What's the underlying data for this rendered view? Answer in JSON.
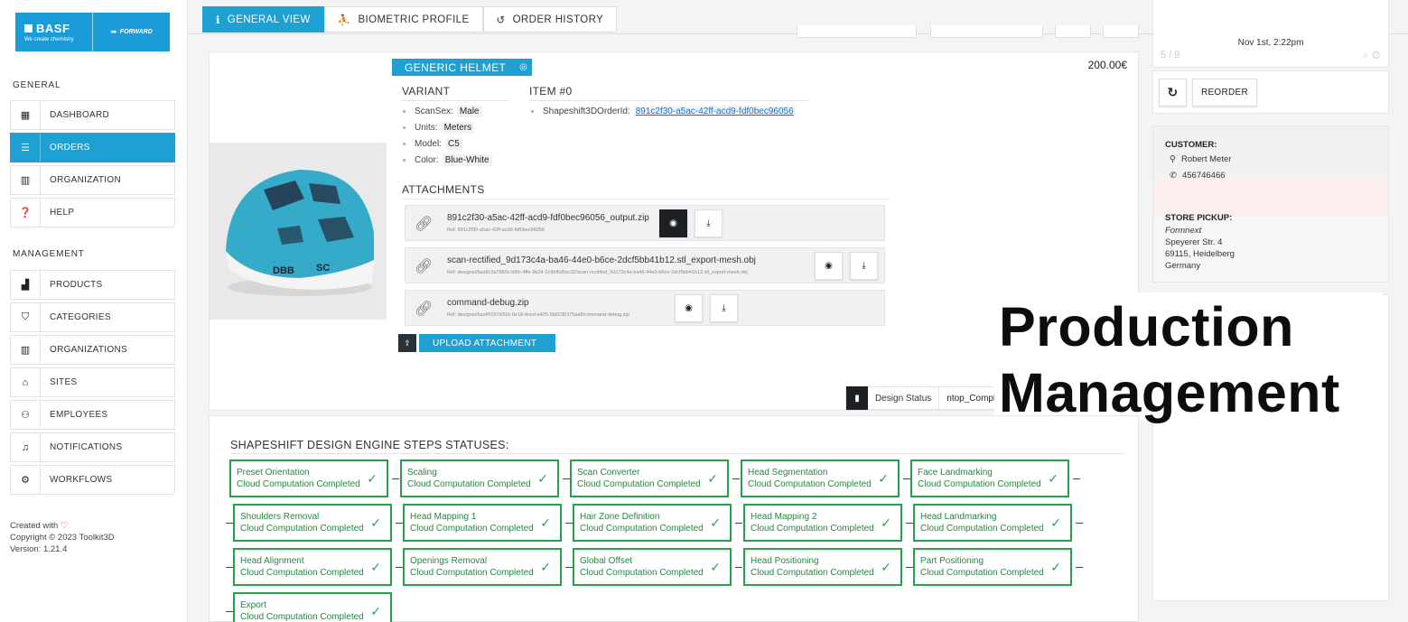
{
  "brand": {
    "name": "BASF",
    "tagline": "We create chemistry",
    "partner": "FORWARD",
    "accent": "#1fa0d2"
  },
  "sidebar": {
    "general_title": "GENERAL",
    "general_items": [
      {
        "label": "DASHBOARD",
        "icon": "dashboard-icon"
      },
      {
        "label": "ORDERS",
        "icon": "orders-icon",
        "active": true
      },
      {
        "label": "ORGANIZATION",
        "icon": "building-icon"
      },
      {
        "label": "HELP",
        "icon": "help-icon"
      }
    ],
    "management_title": "MANAGEMENT",
    "management_items": [
      {
        "label": "PRODUCTS",
        "icon": "products-icon"
      },
      {
        "label": "CATEGORIES",
        "icon": "bookmark-icon"
      },
      {
        "label": "ORGANIZATIONS",
        "icon": "building-icon"
      },
      {
        "label": "SITES",
        "icon": "store-icon"
      },
      {
        "label": "EMPLOYEES",
        "icon": "users-icon"
      },
      {
        "label": "NOTIFICATIONS",
        "icon": "bell-icon"
      },
      {
        "label": "WORKFLOWS",
        "icon": "cogs-icon"
      }
    ],
    "footer": {
      "created": "Created with",
      "copyright": "Copyright © 2023 Toolkit3D",
      "version": "Version: 1.21.4"
    }
  },
  "tabs": [
    {
      "label": "GENERAL VIEW",
      "icon": "info-icon",
      "active": true
    },
    {
      "label": "BIOMETRIC PROFILE",
      "icon": "person-icon"
    },
    {
      "label": "ORDER HISTORY",
      "icon": "history-icon"
    }
  ],
  "item": {
    "product": "GENERIC HELMET",
    "price": "200.00€",
    "variant_title": "VARIANT",
    "variant": [
      {
        "key": "ScanSex:",
        "value": "Male"
      },
      {
        "key": "Units:",
        "value": "Meters"
      },
      {
        "key": "Model:",
        "value": "C5"
      },
      {
        "key": "Color:",
        "value": "Blue-White"
      }
    ],
    "item_title": "ITEM #0",
    "order_key": "Shapeshift3DOrderId:",
    "order_id": "891c2f30-a5ac-42ff-acd9-fdf0bec96056",
    "attachments_title": "ATTACHMENTS",
    "attachments": [
      {
        "name": "891c2f30-a5ac-42ff-acd9-fdf0bec96056_output.zip",
        "ref": "Ref: 891c2f30-a5ac-42ff-acd9-fdf0bec96056"
      },
      {
        "name": "scan-rectified_9d173c4a-ba46-44e0-b6ce-2dcf5bb41b12.stl_export-mesh.obj",
        "ref": "Ref: designs//basf/c3a7880c-b9fc-4ffe-9b34-1c9bf6d5ec32/scan-rectified_9d173c4a-ba46-44e0-b6ce-2dcf5bb41b12.stl_export-mesh.obj"
      },
      {
        "name": "command-debug.zip",
        "ref": "Ref: designs//basf/6037d31b-0e18-4ced-a425-5b6236375aa8/command-debug.zip"
      }
    ],
    "upload_label": "UPLOAD ATTACHMENT",
    "design_status_label": "Design Status",
    "design_status_value": "ntop_Complete"
  },
  "right": {
    "pagination": "5 / 9",
    "date": "Nov 1st, 2:22pm",
    "reorder_label": "REORDER",
    "customer_label": "CUSTOMER:",
    "customer_name": "Robert Meter",
    "customer_phone": "456746466",
    "store_label": "STORE PICKUP:",
    "store_name": "Formnext",
    "store_street": "Speyerer Str. 4",
    "store_city": "69115, Heidelberg",
    "store_country": "Germany"
  },
  "overlay": {
    "line1": "Production",
    "line2": "Management"
  },
  "steps": {
    "title": "SHAPESHIFT DESIGN ENGINE STEPS STATUSES:",
    "status_color": "#27a04c",
    "rows": [
      [
        {
          "name": "Preset Orientation",
          "status": "Cloud Computation Completed"
        },
        {
          "name": "Scaling",
          "status": "Cloud Computation Completed"
        },
        {
          "name": "Scan Converter",
          "status": "Cloud Computation Completed"
        },
        {
          "name": "Head Segmentation",
          "status": "Cloud Computation Completed"
        },
        {
          "name": "Face Landmarking",
          "status": "Cloud Computation Completed"
        }
      ],
      [
        {
          "name": "Shoulders Removal",
          "status": "Cloud Computation Completed"
        },
        {
          "name": "Head Mapping 1",
          "status": "Cloud Computation Completed"
        },
        {
          "name": "Hair Zone Definition",
          "status": "Cloud Computation Completed"
        },
        {
          "name": "Head Mapping 2",
          "status": "Cloud Computation Completed"
        },
        {
          "name": "Head Landmarking",
          "status": "Cloud Computation Completed"
        }
      ],
      [
        {
          "name": "Head Alignment",
          "status": "Cloud Computation Completed"
        },
        {
          "name": "Openings Removal",
          "status": "Cloud Computation Completed"
        },
        {
          "name": "Global Offset",
          "status": "Cloud Computation Completed"
        },
        {
          "name": "Head Positioning",
          "status": "Cloud Computation Completed"
        },
        {
          "name": "Part Positioning",
          "status": "Cloud Computation Completed"
        }
      ],
      [
        {
          "name": "Export",
          "status": "Cloud Computation Completed"
        }
      ]
    ]
  }
}
